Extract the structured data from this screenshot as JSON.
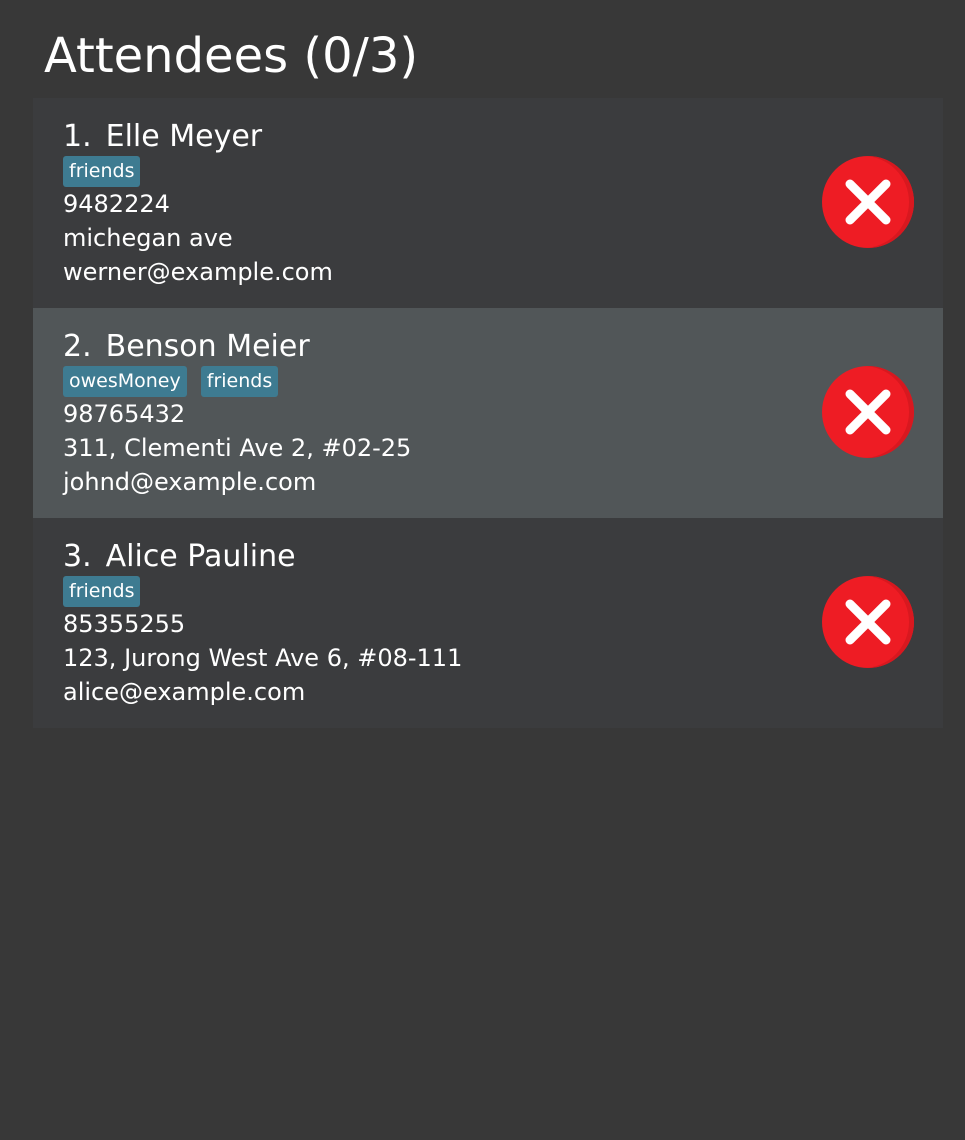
{
  "panel": {
    "title": "Attendees (0/3)"
  },
  "icons": {
    "remove": "close-circle-icon"
  },
  "colors": {
    "background": "#383838",
    "card": "#3b3c3e",
    "card_selected": "#515658",
    "tag": "#3e7b91",
    "remove_button": "#ee1c24"
  },
  "attendees": [
    {
      "index": "1.",
      "name": "Elle Meyer",
      "tags": [
        "friends"
      ],
      "phone": "9482224",
      "address": "michegan ave",
      "email": "werner@example.com",
      "selected": false
    },
    {
      "index": "2.",
      "name": "Benson Meier",
      "tags": [
        "owesMoney",
        "friends"
      ],
      "phone": "98765432",
      "address": "311, Clementi Ave 2, #02-25",
      "email": "johnd@example.com",
      "selected": true
    },
    {
      "index": "3.",
      "name": "Alice Pauline",
      "tags": [
        "friends"
      ],
      "phone": "85355255",
      "address": "123, Jurong West Ave 6, #08-111",
      "email": "alice@example.com",
      "selected": false
    }
  ]
}
